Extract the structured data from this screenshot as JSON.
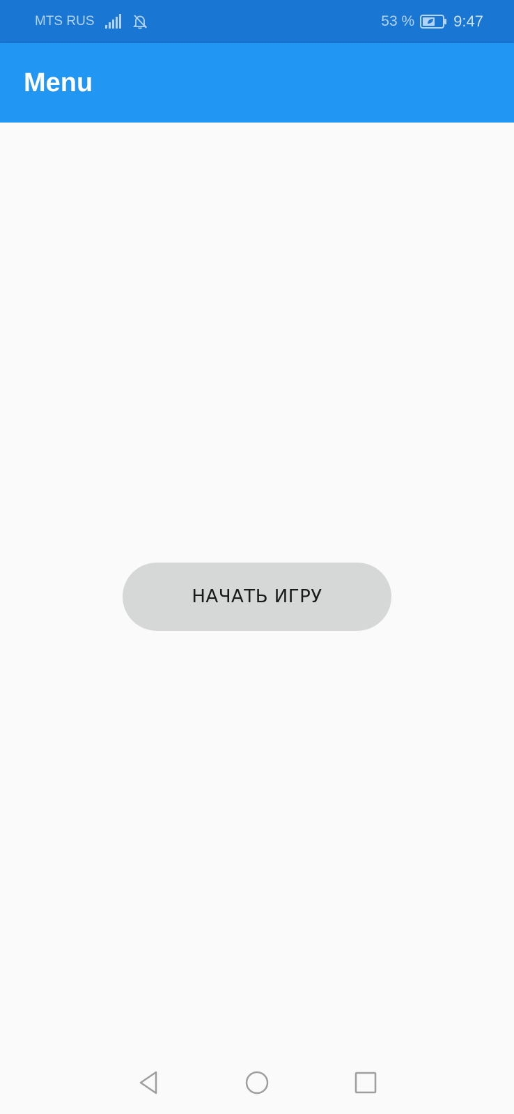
{
  "status_bar": {
    "carrier": "MTS RUS",
    "battery_text": "53 %",
    "time": "9:47",
    "icons": [
      "signal-icon",
      "bell-off-icon",
      "battery-saver-icon"
    ]
  },
  "app_bar": {
    "title": "Menu",
    "color": "#2196f3"
  },
  "main": {
    "start_button_label": "НАЧАТЬ ИГРУ"
  },
  "nav_bar": {
    "icons": [
      "back-icon",
      "home-icon",
      "recents-icon"
    ]
  },
  "colors": {
    "status_bar": "#1976d2",
    "app_bar": "#2196f3",
    "background": "#fafafa",
    "button": "#d6d7d7"
  }
}
